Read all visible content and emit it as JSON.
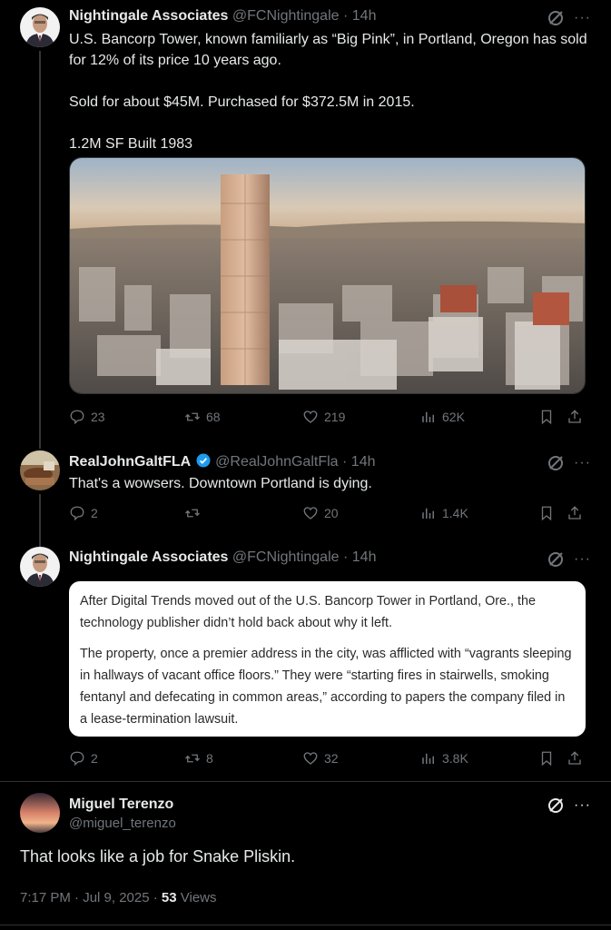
{
  "tweet1": {
    "name": "Nightingale Associates",
    "handle": "@FCNightingale",
    "time": "14h",
    "lines": [
      "U.S. Bancorp Tower, known familiarly as “Big Pink”, in Portland, Oregon has sold for 12% of its price 10 years ago.",
      "Sold for about $45M.   Purchased for $372.5M in 2015.",
      "1.2M SF   Built 1983"
    ],
    "replies": "23",
    "reposts": "68",
    "likes": "219",
    "views": "62K"
  },
  "tweet2": {
    "name": "RealJohnGaltFLA",
    "handle": "@RealJohnGaltFla",
    "time": "14h",
    "text": "That's a wowsers. Downtown Portland is dying.",
    "replies": "2",
    "reposts": "",
    "likes": "20",
    "views": "1.4K"
  },
  "tweet3": {
    "name": "Nightingale Associates",
    "handle": "@FCNightingale",
    "time": "14h",
    "quote_p1": "After Digital Trends moved out of the U.S. Bancorp Tower in Portland, Ore., the technology publisher didn’t hold back about why it left.",
    "quote_p2": "The property, once a premier address in the city, was afflicted with “vagrants sleeping in hallways of vacant office floors.” They were “starting fires in stairwells, smoking fentanyl and defecating in common areas,” according to papers the company filed in a lease-termination lawsuit.",
    "replies": "2",
    "reposts": "8",
    "likes": "32",
    "views": "3.8K"
  },
  "tweet4": {
    "name": "Miguel Terenzo",
    "handle": "@miguel_terenzo",
    "text": "That looks like a job for Snake Pliskin.",
    "time": "7:17 PM · Jul 9, 2025 · ",
    "views_count": "53",
    "views_label": " Views"
  },
  "colors": {
    "background": "#000000",
    "text": "#e7e9ea",
    "muted": "#71767b",
    "verified": "#1d9bf0"
  }
}
